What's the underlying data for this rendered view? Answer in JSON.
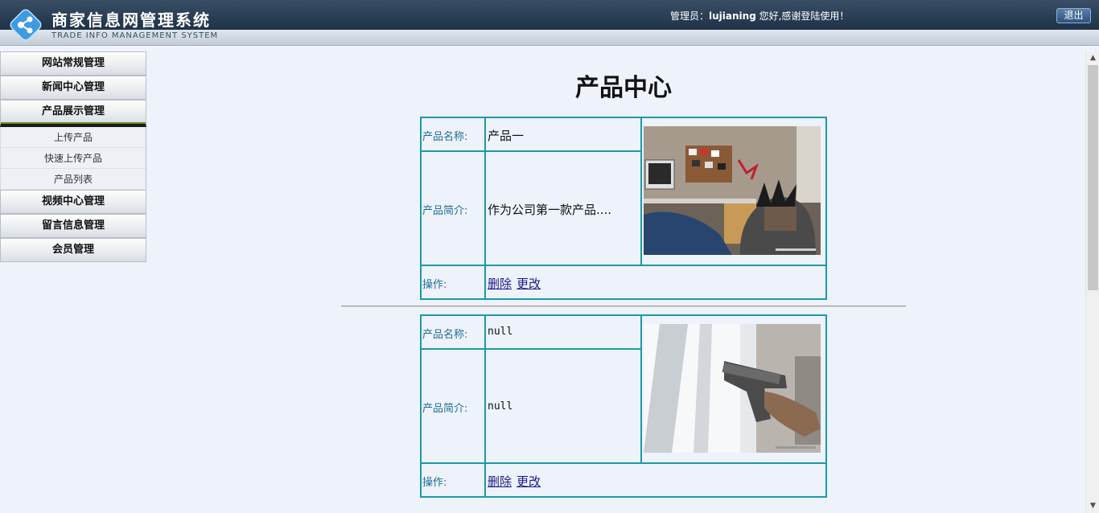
{
  "header": {
    "title": "商家信息网管理系统",
    "subtitle": "TRADE INFO MANAGEMENT SYSTEM",
    "welcome_prefix": "管理员：",
    "username": "lujianing",
    "welcome_suffix": " 您好,感谢登陆使用！",
    "logout_label": "退出"
  },
  "sidebar": {
    "menus": [
      {
        "label": "网站常规管理"
      },
      {
        "label": "新闻中心管理"
      },
      {
        "label": "产品展示管理"
      },
      {
        "label": "视频中心管理"
      },
      {
        "label": "留言信息管理"
      },
      {
        "label": "会员管理"
      }
    ],
    "product_submenu": [
      {
        "label": "上传产品"
      },
      {
        "label": "快速上传产品"
      },
      {
        "label": "产品列表"
      }
    ]
  },
  "main": {
    "page_title": "产品中心",
    "labels": {
      "name": "产品名称:",
      "intro": "产品简介:",
      "actions": "操作:"
    },
    "products": [
      {
        "name": "产品一",
        "intro": "作为公司第一款产品....",
        "delete_label": "删除",
        "edit_label": "更改"
      },
      {
        "name": "null",
        "intro": "null",
        "delete_label": "删除",
        "edit_label": "更改"
      }
    ]
  },
  "colors": {
    "header_bg": "#22364c",
    "page_bg": "#eef2fb",
    "table_border": "#1a9aa8",
    "label_text": "#1f6f94",
    "link_text": "#1a1a8a"
  }
}
